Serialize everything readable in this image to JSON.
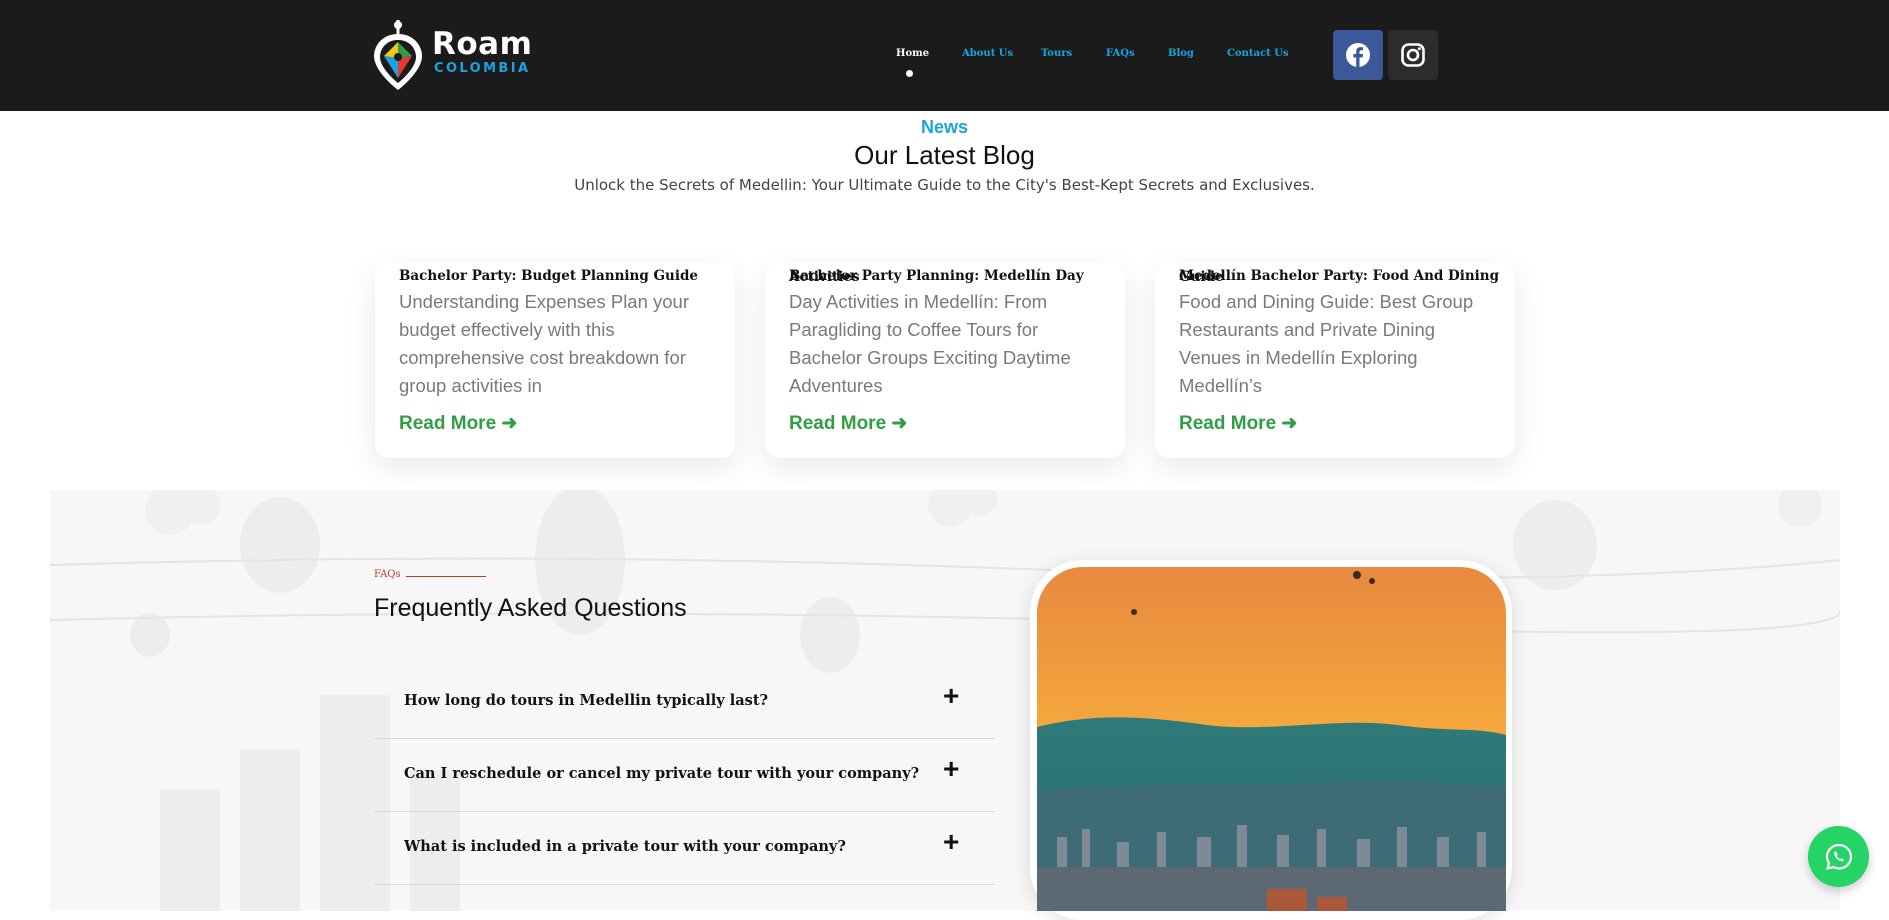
{
  "brand": {
    "name": "Roam",
    "sub": "COLOMBIA"
  },
  "nav": {
    "items": [
      "Home",
      "About Us",
      "Tours",
      "FAQs",
      "Blog",
      "Contact Us"
    ]
  },
  "social": {
    "facebook_icon": "facebook-icon",
    "instagram_icon": "instagram-icon"
  },
  "blog": {
    "kicker": "News",
    "title": "Our Latest Blog",
    "subtitle": "Unlock the Secrets of Medellin: Your Ultimate Guide to the City's Best-Kept Secrets and Exclusives.",
    "cards": [
      {
        "title": "Bachelor Party: Budget Planning Guide",
        "title_overlap": "",
        "text": "Understanding Expenses Plan your budget effectively with this comprehensive cost breakdown for group activities in",
        "more": "Read More ➜"
      },
      {
        "title": "Bachelor Party Planning: Medellín Day",
        "title_overlap": "Activities",
        "text": "Day Activities in Medellín: From Paragliding to Coffee Tours for Bachelor Groups Exciting Daytime Adventures",
        "more": "Read More ➜"
      },
      {
        "title": "Medellín Bachelor Party: Food And Dining",
        "title_overlap": "Guide",
        "text": "Food and Dining Guide: Best Group Restaurants and Private Dining Venues in Medellín Exploring Medellín’s",
        "more": "Read More ➜"
      }
    ]
  },
  "faq": {
    "kicker": "FAQs",
    "title": "Frequently Asked Questions",
    "items": [
      {
        "q": "How long do tours in Medellin typically last?",
        "icon": "+"
      },
      {
        "q": "Can I reschedule or cancel my private tour with your company?",
        "icon": "+"
      },
      {
        "q": "What is included in a private tour with your company?",
        "icon": "+"
      }
    ]
  },
  "colors": {
    "header_bg": "#1b1b1b",
    "accent_blue": "#1aa3df",
    "read_more_green": "#2f9e44",
    "faq_red": "#c0392b",
    "whatsapp_green": "#25d366"
  }
}
